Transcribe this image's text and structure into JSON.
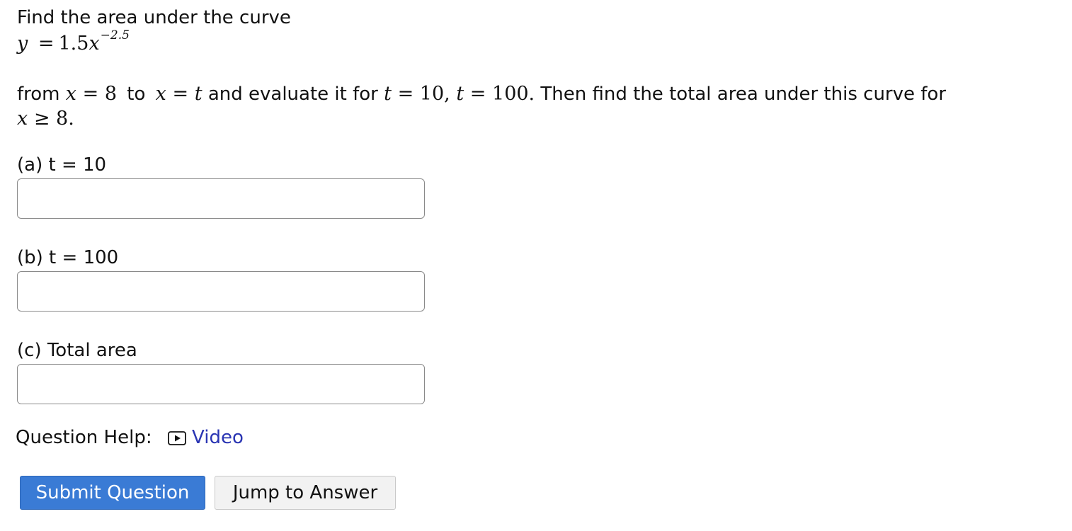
{
  "question": {
    "intro": "Find the area under the curve",
    "equation": {
      "lhs": "y",
      "eq": "=",
      "coef": "1.5",
      "var": "x",
      "exponent": "−2.5"
    },
    "body": {
      "from": "from",
      "x1": "x",
      "eq1": "=",
      "a": "8",
      "to": "to",
      "x2": "x",
      "eq2": "=",
      "t1": "t",
      "mid": "and evaluate it for",
      "t2": "t",
      "eq3": "=",
      "v1": "10,",
      "t3": "t",
      "eq4": "=",
      "v2": "100.",
      "tail": "Then find the total area under this curve for"
    },
    "condition": {
      "x": "x",
      "ge": "≥",
      "value": "8."
    }
  },
  "parts": [
    {
      "label": "(a) t = 10",
      "value": ""
    },
    {
      "label": "(b) t = 100",
      "value": ""
    },
    {
      "label": "(c) Total area",
      "value": ""
    }
  ],
  "help": {
    "label": "Question Help:",
    "video_label": "Video",
    "icon": "play-icon",
    "link_color": "#2a35b3"
  },
  "buttons": {
    "submit_label": "Submit Question",
    "jump_label": "Jump to Answer",
    "submit_color": "#3a7bd5"
  }
}
